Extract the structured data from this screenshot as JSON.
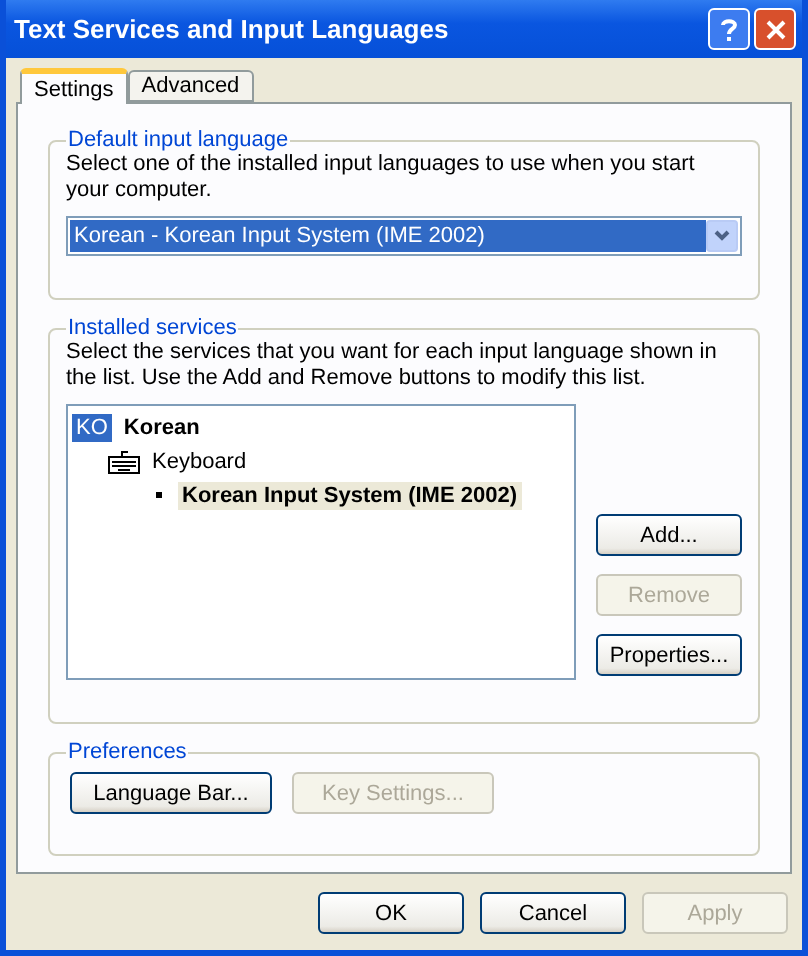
{
  "window": {
    "title": "Text Services and Input Languages"
  },
  "tabs": [
    {
      "label": "Settings",
      "selected": true
    },
    {
      "label": "Advanced",
      "selected": false
    }
  ],
  "default_language": {
    "title": "Default input language",
    "description": "Select one of the installed input languages to use when you start your computer.",
    "dropdown": {
      "value": "Korean - Korean Input System (IME 2002)"
    }
  },
  "installed_services": {
    "title": "Installed services",
    "description": "Select the services that you want for each input language shown in the list. Use the Add and Remove buttons to modify this list.",
    "tree": [
      {
        "kind": "language",
        "badge": "KO",
        "label": "Korean",
        "selected": false,
        "children": [
          {
            "kind": "category",
            "label": "Keyboard",
            "selected": false,
            "children": [
              {
                "kind": "service",
                "label": "Korean Input System (IME 2002)",
                "selected": true
              }
            ]
          }
        ]
      }
    ],
    "buttons": [
      {
        "label": "Add...",
        "disabled": false
      },
      {
        "label": "Remove",
        "disabled": true
      },
      {
        "label": "Properties...",
        "disabled": false
      }
    ]
  },
  "preferences": {
    "title": "Preferences",
    "buttons": [
      {
        "label": "Language Bar...",
        "disabled": false
      },
      {
        "label": "Key Settings...",
        "disabled": true
      }
    ]
  },
  "footer_buttons": [
    {
      "label": "OK",
      "disabled": false
    },
    {
      "label": "Cancel",
      "disabled": false
    },
    {
      "label": "Apply",
      "disabled": true
    }
  ]
}
